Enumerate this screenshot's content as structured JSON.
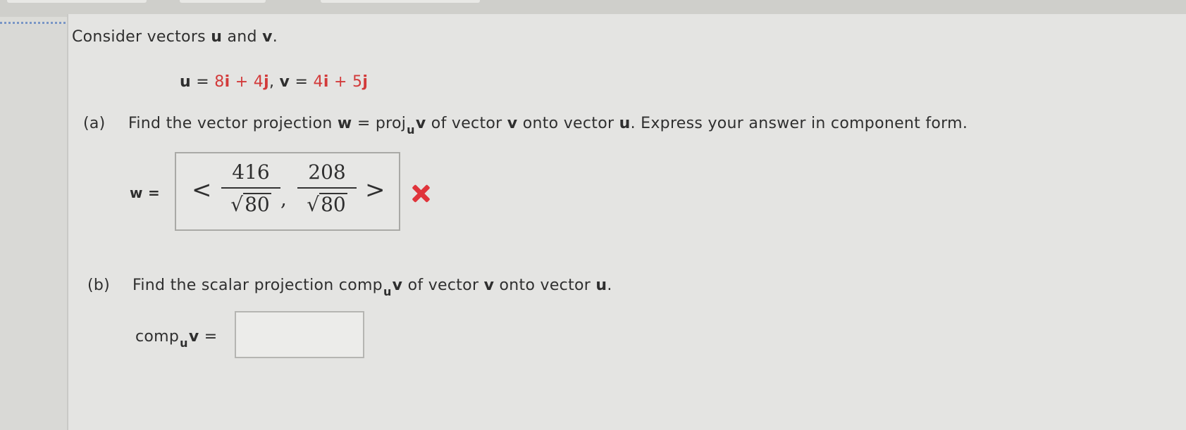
{
  "problem": {
    "intro_prefix": "Consider vectors ",
    "intro_u": "u",
    "intro_and": " and ",
    "intro_v": "v",
    "intro_period": ".",
    "given": {
      "u_var": "u",
      "eq1": " = ",
      "u_i_coef": "8",
      "i1": "i",
      "plus1": " + ",
      "u_j_coef": "4",
      "j1": "j",
      "sep": ",   ",
      "v_var": "v",
      "eq2": " = ",
      "v_i_coef": "4",
      "i2": "i",
      "plus2": " + ",
      "v_j_coef": "5",
      "j2": "j"
    }
  },
  "part_a": {
    "label": "(a)",
    "text1": "Find the vector projection ",
    "w": "w",
    "text2": " = proj",
    "sub": "u",
    "v": "v",
    "text3": " of vector ",
    "v2": "v",
    "text4": " onto vector ",
    "u": "u",
    "text5": ". Express your answer in component form.",
    "answer_label": "w =",
    "answer": {
      "open": "<",
      "num1": "416",
      "den1": "80",
      "comma": ",",
      "num2": "208",
      "den2": "80",
      "close": ">"
    }
  },
  "part_b": {
    "label": "(b)",
    "text1": "Find the scalar projection comp",
    "sub": "u",
    "v": "v",
    "text2": " of vector ",
    "v2": "v",
    "text3": " onto vector ",
    "u": "u",
    "text4": ".",
    "answer_label_comp": "comp",
    "answer_label_sub": "u",
    "answer_label_v": "v",
    "answer_label_eq": " =",
    "answer_value": ""
  },
  "colors": {
    "vector_symbol": "#d23a3a",
    "incorrect_mark": "#e0343b"
  },
  "icons": {
    "status": "x-icon"
  }
}
